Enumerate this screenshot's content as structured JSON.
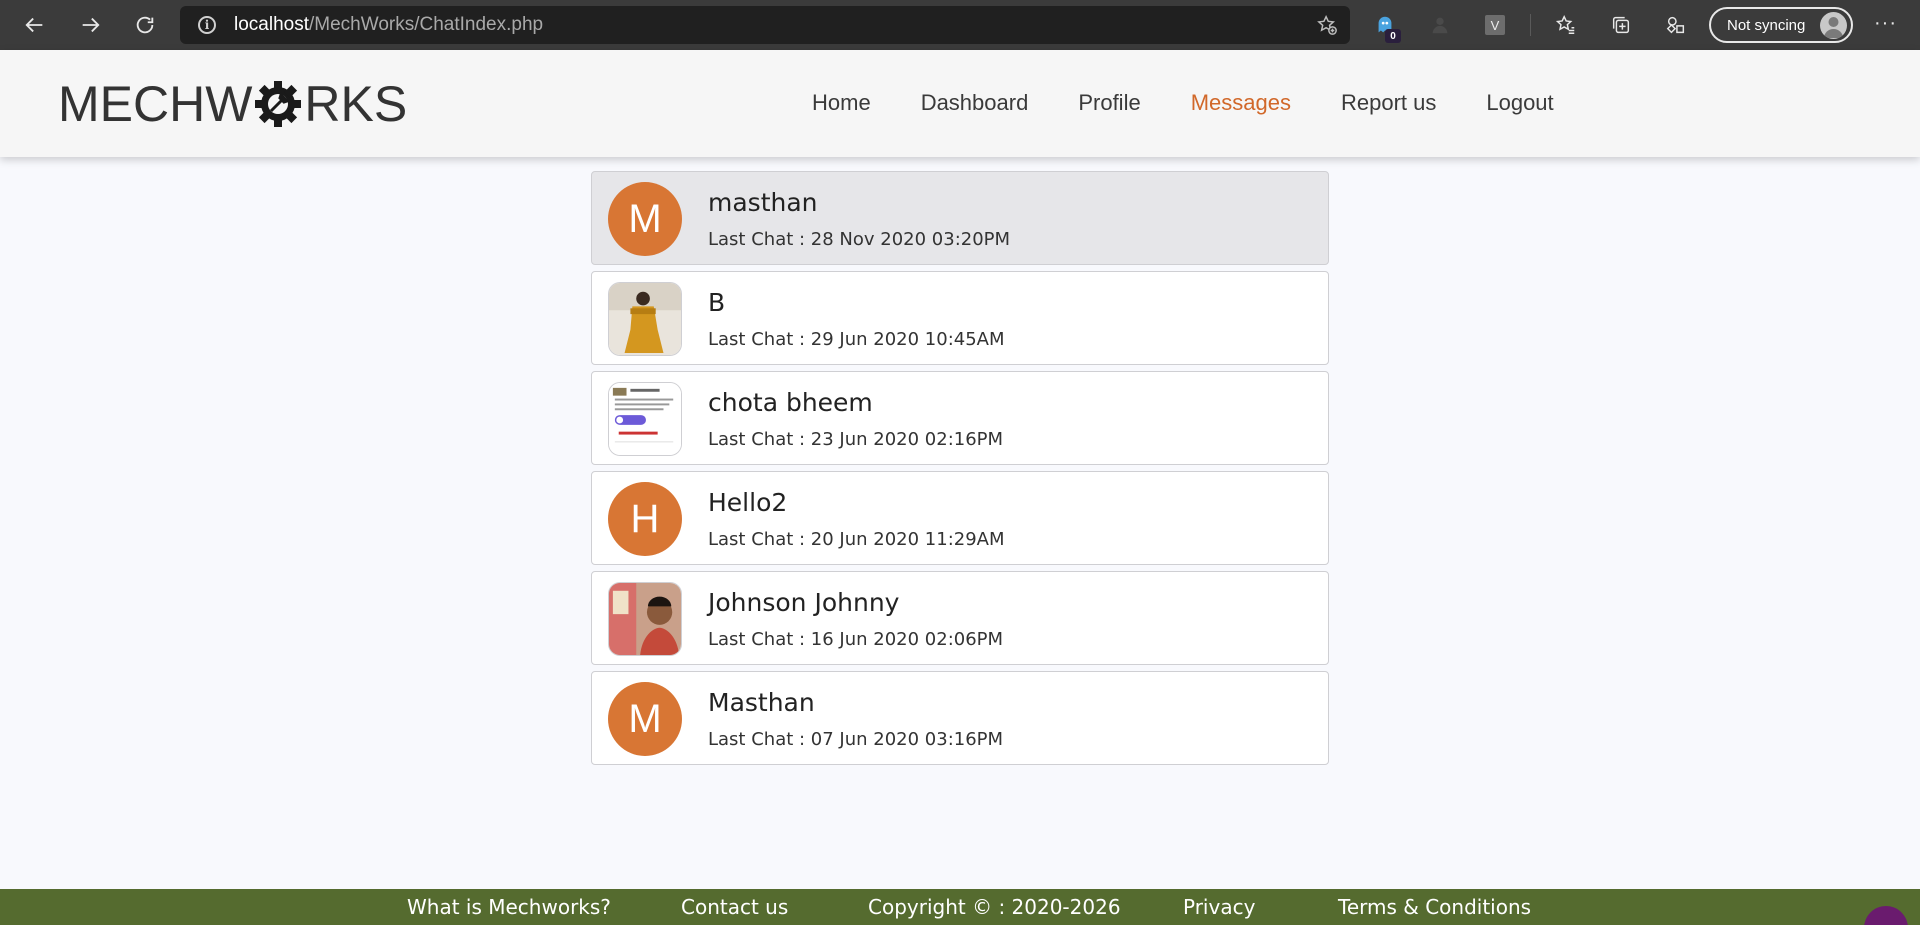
{
  "browser": {
    "url_host": "localhost",
    "url_path": "/MechWorks/ChatIndex.php",
    "extension_badge": "0",
    "extension_letter": "V",
    "sync_label": "Not syncing"
  },
  "header": {
    "logo_left": "MECHW",
    "logo_right": "RKS",
    "nav": [
      {
        "label": "Home"
      },
      {
        "label": "Dashboard"
      },
      {
        "label": "Profile"
      },
      {
        "label": "Messages"
      },
      {
        "label": "Report us"
      },
      {
        "label": "Logout"
      }
    ],
    "active_nav": "Messages",
    "accent_color": "#d1682a"
  },
  "chats": [
    {
      "name": "masthan",
      "last_chat": "Last Chat : 28 Nov 2020 03:20PM",
      "avatar_letter": "M",
      "avatar_type": "letter",
      "selected": true
    },
    {
      "name": "B",
      "last_chat": "Last Chat : 29 Jun 2020 10:45AM",
      "avatar_letter": "",
      "avatar_type": "photo"
    },
    {
      "name": "chota bheem",
      "last_chat": "Last Chat : 23 Jun 2020 02:16PM",
      "avatar_letter": "",
      "avatar_type": "photo"
    },
    {
      "name": "Hello2",
      "last_chat": "Last Chat : 20 Jun 2020 11:29AM",
      "avatar_letter": "H",
      "avatar_type": "letter"
    },
    {
      "name": "Johnson Johnny",
      "last_chat": "Last Chat : 16 Jun 2020 02:06PM",
      "avatar_letter": "",
      "avatar_type": "photo"
    },
    {
      "name": "Masthan",
      "last_chat": "Last Chat : 07 Jun 2020 03:16PM",
      "avatar_letter": "M",
      "avatar_type": "letter"
    }
  ],
  "avatar_color": "#d87634",
  "footer": {
    "links": [
      {
        "label": "What is Mechworks?"
      },
      {
        "label": "Contact us"
      },
      {
        "label": "Copyright © : 2020-2026"
      },
      {
        "label": "Privacy"
      },
      {
        "label": "Terms & Conditions"
      }
    ],
    "background": "#556b2f"
  }
}
